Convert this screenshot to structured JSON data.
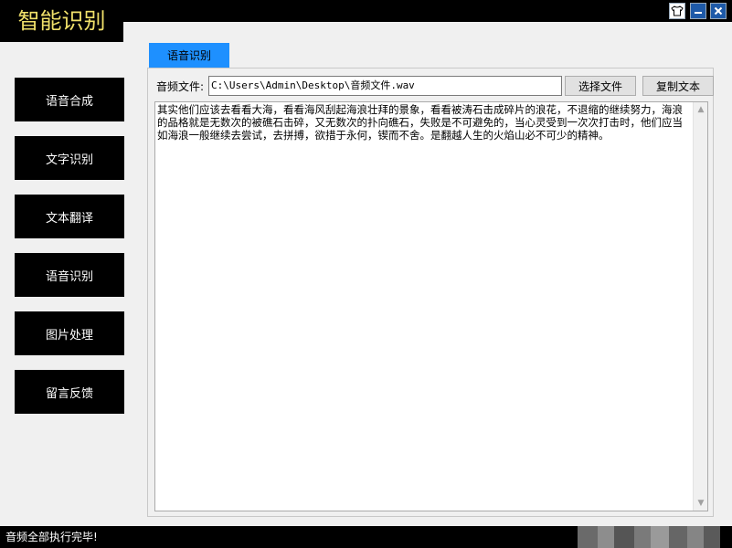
{
  "app": {
    "title": "智能识别"
  },
  "window_controls": {
    "skin_icon": "shirt-icon",
    "minimize_icon": "minimize-icon",
    "close_icon": "close-icon"
  },
  "sidebar": {
    "items": [
      {
        "label": "语音合成"
      },
      {
        "label": "文字识别"
      },
      {
        "label": "文本翻译"
      },
      {
        "label": "语音识别"
      },
      {
        "label": "图片处理"
      },
      {
        "label": "留言反馈"
      }
    ]
  },
  "tab": {
    "active_label": "语音识别"
  },
  "file": {
    "label": "音频文件:",
    "path": "C:\\Users\\Admin\\Desktop\\音频文件.wav",
    "choose_button": "选择文件",
    "copy_button": "复制文本"
  },
  "result": {
    "text": "其实他们应该去看看大海，看看海风刮起海浪壮拜的景象，看看被涛石击成碎片的浪花，不退缩的继续努力，海浪的品格就是无数次的被礁石击碎，又无数次的扑向礁石，失败是不可避免的，当心灵受到一次次打击时，他们应当如海浪一般继续去尝试，去拼搏，欲措于永何，锲而不舍。是翻越人生的火焰山必不可少的精神。"
  },
  "status": {
    "text": "音频全部执行完毕!"
  },
  "colors": {
    "accent": "#1e90ff",
    "title": "#f0e06a",
    "sidebar_bg": "#000000"
  }
}
